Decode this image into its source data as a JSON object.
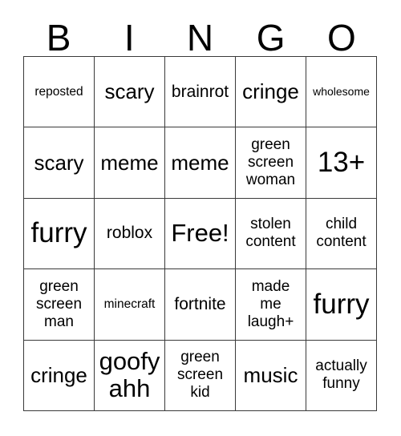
{
  "header": {
    "letters": [
      "B",
      "I",
      "N",
      "G",
      "O"
    ]
  },
  "grid": {
    "columns": 5,
    "rows": 5,
    "cells": [
      {
        "text": "reposted",
        "size": "sz-s"
      },
      {
        "text": "scary",
        "size": "sz-l"
      },
      {
        "text": "brainrot",
        "size": "sz-ml"
      },
      {
        "text": "cringe",
        "size": "sz-l"
      },
      {
        "text": "wholesome",
        "size": "sz-xs"
      },
      {
        "text": "scary",
        "size": "sz-l"
      },
      {
        "text": "meme",
        "size": "sz-l"
      },
      {
        "text": "meme",
        "size": "sz-l"
      },
      {
        "text": "green\nscreen\nwoman",
        "size": "sz-m"
      },
      {
        "text": "13+",
        "size": "sz-xxl"
      },
      {
        "text": "furry",
        "size": "sz-xxl"
      },
      {
        "text": "roblox",
        "size": "sz-ml"
      },
      {
        "text": "Free!",
        "size": "sz-xl"
      },
      {
        "text": "stolen\ncontent",
        "size": "sz-m"
      },
      {
        "text": "child\ncontent",
        "size": "sz-m"
      },
      {
        "text": "green\nscreen\nman",
        "size": "sz-m"
      },
      {
        "text": "minecraft",
        "size": "sz-s"
      },
      {
        "text": "fortnite",
        "size": "sz-ml"
      },
      {
        "text": "made\nme\nlaugh+",
        "size": "sz-m"
      },
      {
        "text": "furry",
        "size": "sz-xxl"
      },
      {
        "text": "cringe",
        "size": "sz-l"
      },
      {
        "text": "goofy\nahh",
        "size": "sz-xl"
      },
      {
        "text": "green\nscreen\nkid",
        "size": "sz-m"
      },
      {
        "text": "music",
        "size": "sz-l"
      },
      {
        "text": "actually\nfunny",
        "size": "sz-m"
      }
    ]
  },
  "colors": {
    "background": "#ffffff",
    "text": "#000000",
    "border": "#3a3a3a"
  }
}
